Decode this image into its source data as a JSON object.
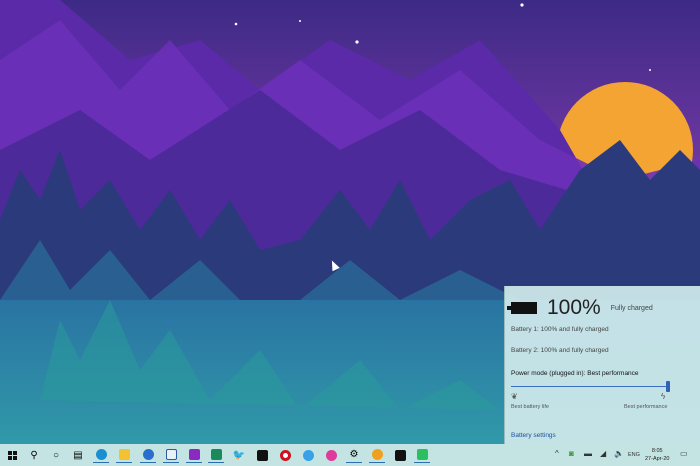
{
  "battery_flyout": {
    "percent": "100%",
    "status": "Fully charged",
    "battery1": "Battery 1: 100% and fully charged",
    "battery2": "Battery 2: 100% and fully charged",
    "power_mode": "Power mode (plugged in): Best performance",
    "slider_value_percent": 100,
    "left_label": "Best battery life",
    "right_label": "Best performance",
    "settings_link": "Battery settings"
  },
  "taskbar": {
    "apps": [
      "start",
      "search",
      "cortana",
      "task-view",
      "edge",
      "file-explorer",
      "thunderbird",
      "notepad",
      "onenote",
      "whatsapp",
      "inkscape",
      "task-monitor",
      "opera",
      "browser",
      "help",
      "settings",
      "chrome-canary",
      "store",
      "spotify"
    ],
    "tray": {
      "language": "ENG",
      "time": "8:05",
      "date": "27-Apr-20"
    }
  },
  "colors": {
    "accent": "#2f62b8",
    "taskbar": "#c3e4e2"
  }
}
